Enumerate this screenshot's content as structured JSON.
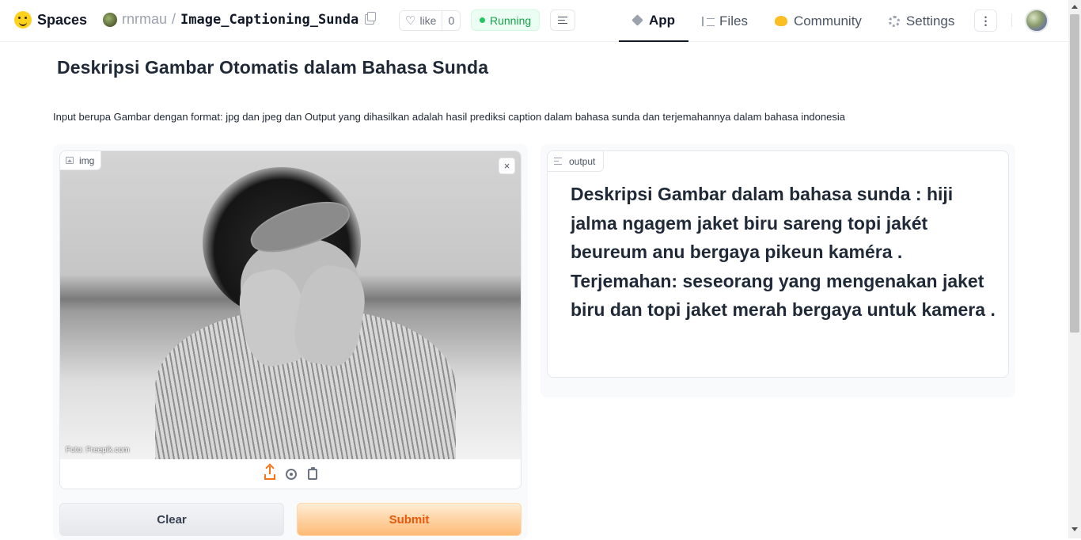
{
  "header": {
    "brand": "Spaces",
    "owner": "rnrmau",
    "separator": "/",
    "repo_name": "Image_Captioning_Sunda",
    "like_label": "like",
    "like_count": "0",
    "status": "Running",
    "status_color": "#16a34a",
    "nav": [
      {
        "label": "App",
        "icon": "cube-icon"
      },
      {
        "label": "Files",
        "icon": "files-icon"
      },
      {
        "label": "Community",
        "icon": "community-icon"
      },
      {
        "label": "Settings",
        "icon": "gear-icon"
      }
    ],
    "more_label": "⋮"
  },
  "main": {
    "title": "Deskripsi Gambar Otomatis dalam Bahasa Sunda",
    "description": "Input berupa Gambar dengan format: jpg dan jpeg dan Output yang dihasilkan adalah hasil prediksi caption dalam bahasa sunda dan terjemahannya dalam bahasa indonesia",
    "image_input": {
      "label": "img",
      "clear_label": "×",
      "photo_credit": "Foto: Freepik.com",
      "sources": [
        "upload-icon",
        "webcam-icon",
        "clipboard-icon"
      ]
    },
    "output": {
      "label": "output",
      "text": "Deskripsi Gambar dalam bahasa sunda : hiji jalma ngagem jaket biru sareng topi jakét beureum anu bergaya pikeun kaméra . Terjemahan: seseorang yang mengenakan jaket biru dan topi jaket merah bergaya untuk kamera ."
    },
    "buttons": {
      "clear": "Clear",
      "submit": "Submit",
      "submit_color": "#ea580c"
    }
  }
}
